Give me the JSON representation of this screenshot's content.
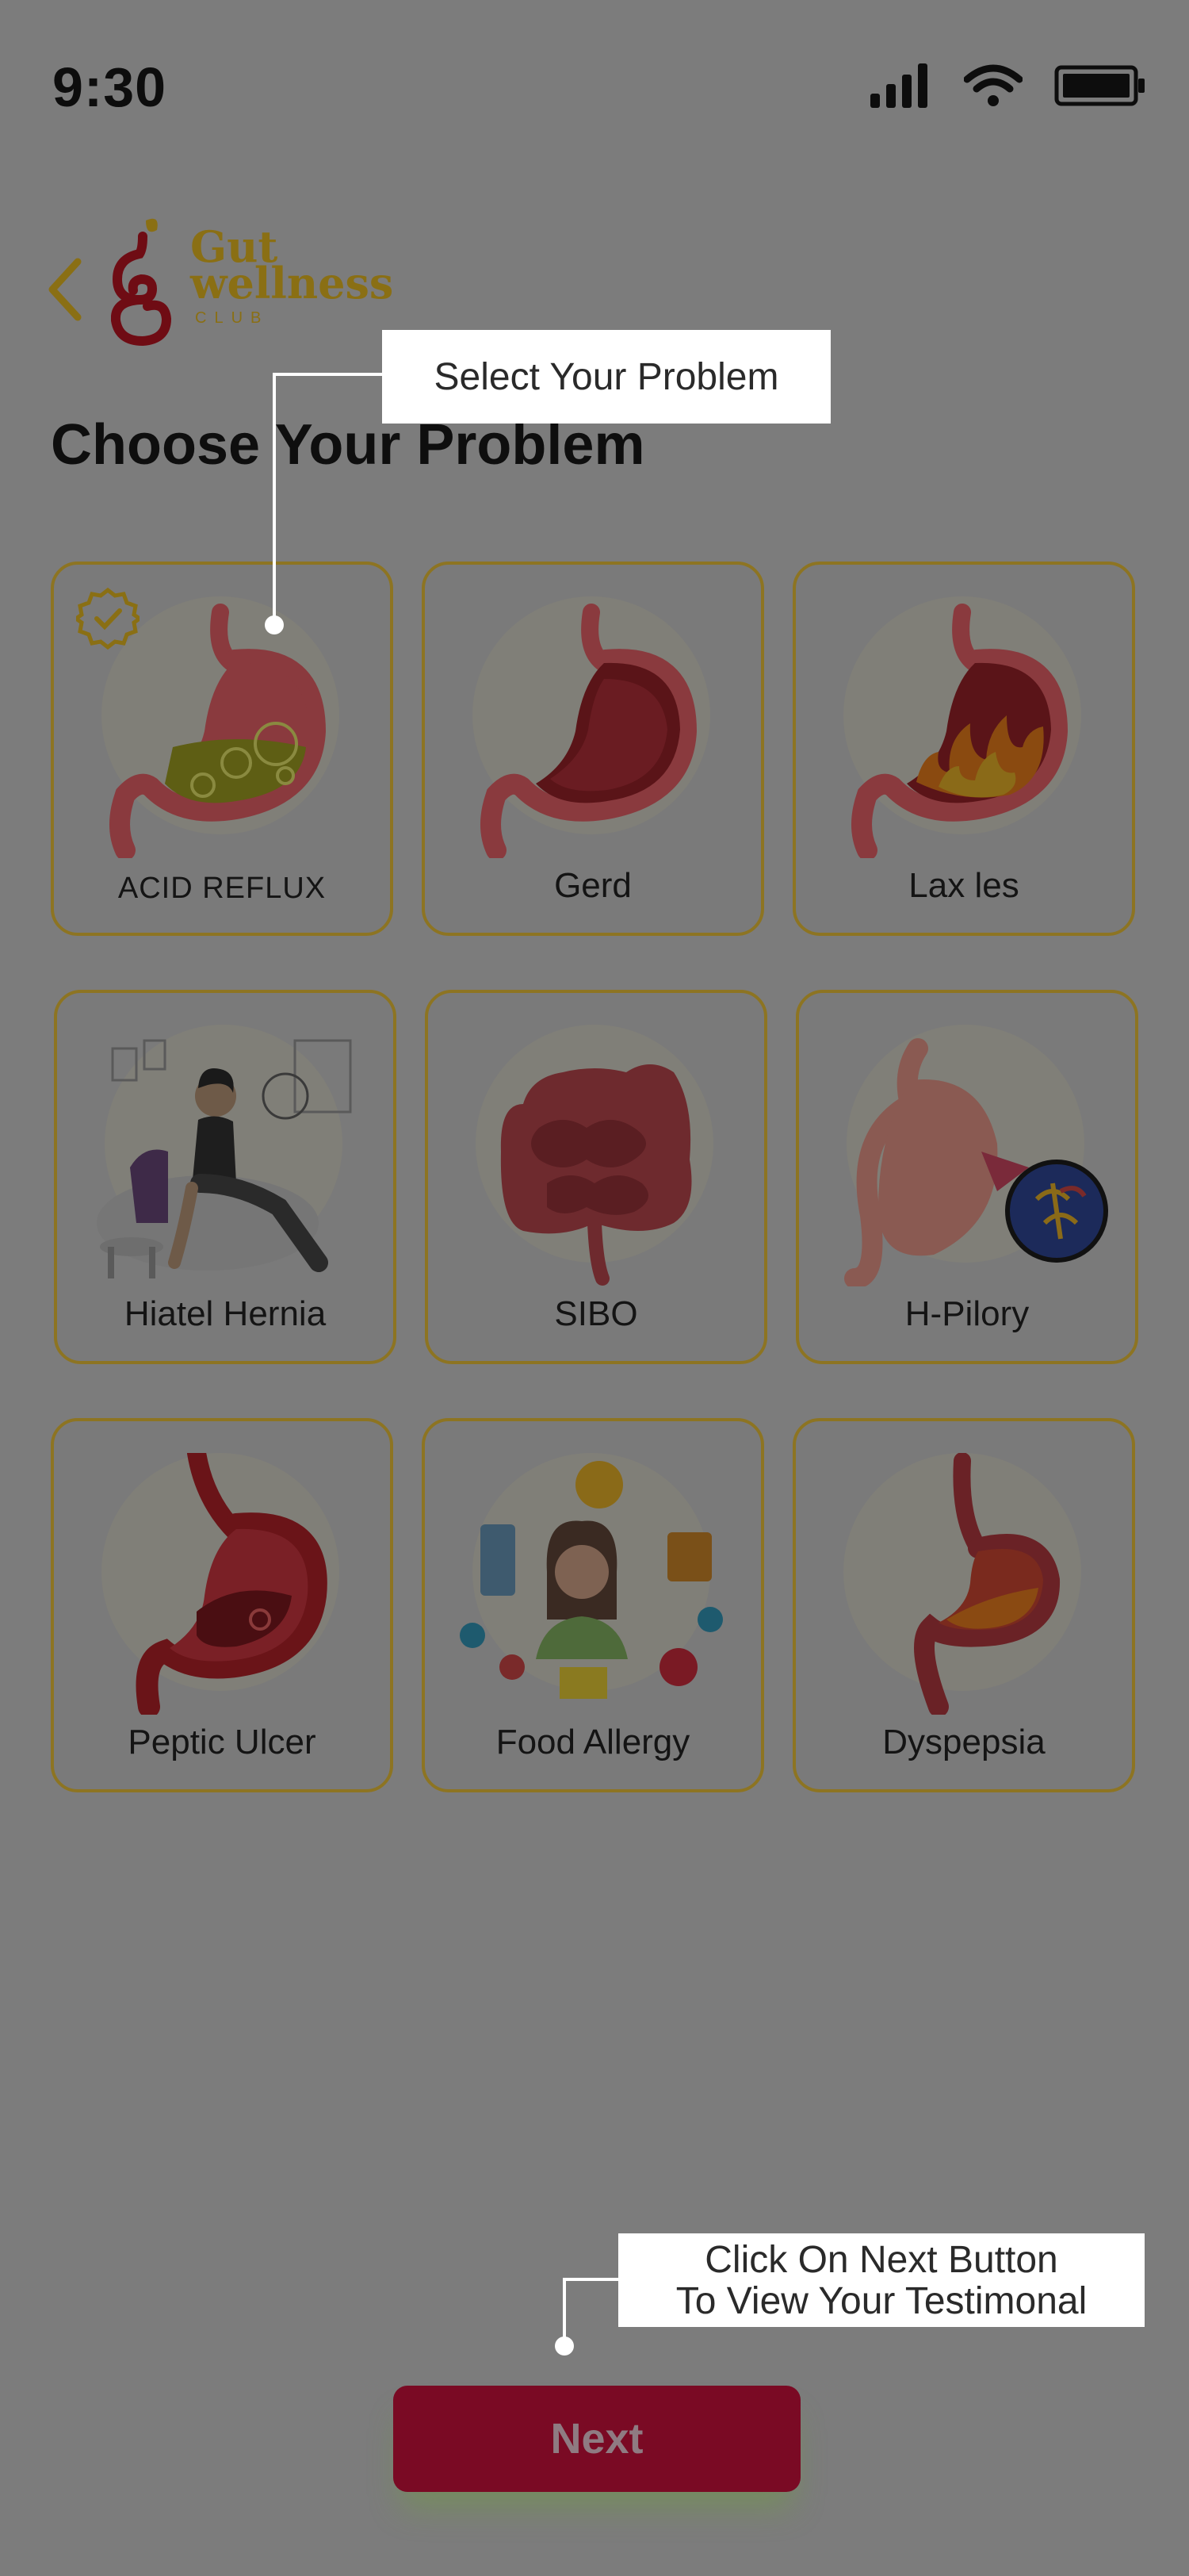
{
  "status_bar": {
    "time": "9:30"
  },
  "header": {
    "back_icon": "chevron-left-icon",
    "logo": {
      "line1": "Gut",
      "line2": "wellness",
      "line3": "CLUB"
    }
  },
  "page_title": "Choose Your Problem",
  "problems": [
    {
      "label": "ACID REFLUX",
      "selected": true,
      "icon": "stomach-acid-icon"
    },
    {
      "label": "Gerd",
      "selected": false,
      "icon": "stomach-icon"
    },
    {
      "label": "Lax les",
      "selected": false,
      "icon": "stomach-fire-icon"
    },
    {
      "label": "Hiatel Hernia",
      "selected": false,
      "icon": "woman-sitting-icon"
    },
    {
      "label": "SIBO",
      "selected": false,
      "icon": "intestines-icon"
    },
    {
      "label": "H-Pilory",
      "selected": false,
      "icon": "stomach-bacteria-icon"
    },
    {
      "label": "Peptic Ulcer",
      "selected": false,
      "icon": "stomach-ulcer-icon"
    },
    {
      "label": "Food Allergy",
      "selected": false,
      "icon": "woman-food-icon"
    },
    {
      "label": "Dyspepsia",
      "selected": false,
      "icon": "esophagus-stomach-icon"
    }
  ],
  "tooltips": {
    "select": "Select Your  Problem",
    "next_line1": "Click On Next Button",
    "next_line2": "To View Your Testimonal"
  },
  "next_button": "Next",
  "colors": {
    "overlay_bg": "#7c7c7c",
    "card_border": "#8d7422",
    "accent_gold": "#8a6f14",
    "button_bg": "#7a0a24"
  }
}
